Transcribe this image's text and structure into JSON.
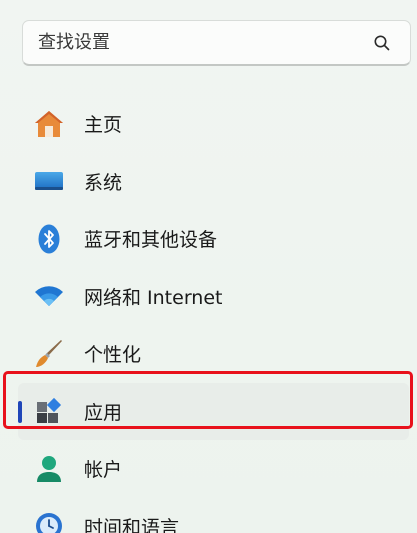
{
  "search": {
    "placeholder": "查找设置"
  },
  "nav": {
    "items": [
      {
        "label": "主页",
        "icon": "home-icon"
      },
      {
        "label": "系统",
        "icon": "display-icon"
      },
      {
        "label": "蓝牙和其他设备",
        "icon": "bluetooth-icon"
      },
      {
        "label": "网络和 Internet",
        "icon": "wifi-icon"
      },
      {
        "label": "个性化",
        "icon": "paintbrush-icon"
      },
      {
        "label": "应用",
        "icon": "apps-icon",
        "selected": true
      },
      {
        "label": "帐户",
        "icon": "account-icon"
      },
      {
        "label": "时间和语言",
        "icon": "clock-globe-icon"
      }
    ]
  },
  "colors": {
    "accent": "#1f46b8",
    "highlight_annotation": "#e8111b"
  }
}
